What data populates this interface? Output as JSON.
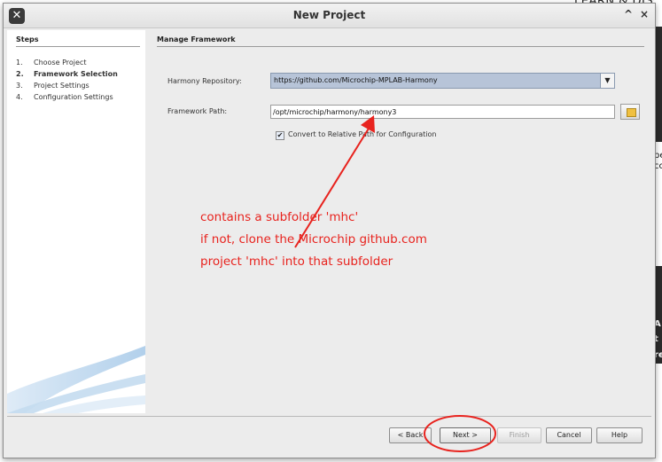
{
  "background": {
    "top_text": "LEARN & DISC",
    "right_fragments": [
      "pe",
      "cc",
      "A",
      "t",
      "re"
    ]
  },
  "window": {
    "title": "New Project",
    "minimize_glyph": "^",
    "close_glyph": "×"
  },
  "steps_panel": {
    "heading": "Steps",
    "items": [
      {
        "num": "1.",
        "label": "Choose Project"
      },
      {
        "num": "2.",
        "label": "Framework Selection"
      },
      {
        "num": "3.",
        "label": "Project Settings"
      },
      {
        "num": "4.",
        "label": "Configuration Settings"
      }
    ],
    "active_index": 1
  },
  "main": {
    "heading": "Manage Framework",
    "harmony_repository": {
      "label": "Harmony Repository:",
      "value": "https://github.com/Microchip-MPLAB-Harmony"
    },
    "framework_path": {
      "label": "Framework Path:",
      "value": "/opt/microchip/harmony/harmony3"
    },
    "convert_relative": {
      "checked": true,
      "label": "Convert to Relative Path for Configuration"
    }
  },
  "annotation": {
    "lines": [
      "contains a subfolder 'mhc'",
      "if not, clone the Microchip github.com",
      "project 'mhc' into that subfolder"
    ],
    "color": "#e8231e"
  },
  "footer": {
    "back": "< Back",
    "next": "Next >",
    "finish": "Finish",
    "cancel": "Cancel",
    "help": "Help"
  },
  "colors": {
    "window_bg": "#ececec",
    "combo_selected_bg": "#b7c4d8",
    "annotation_red": "#e8231e"
  }
}
